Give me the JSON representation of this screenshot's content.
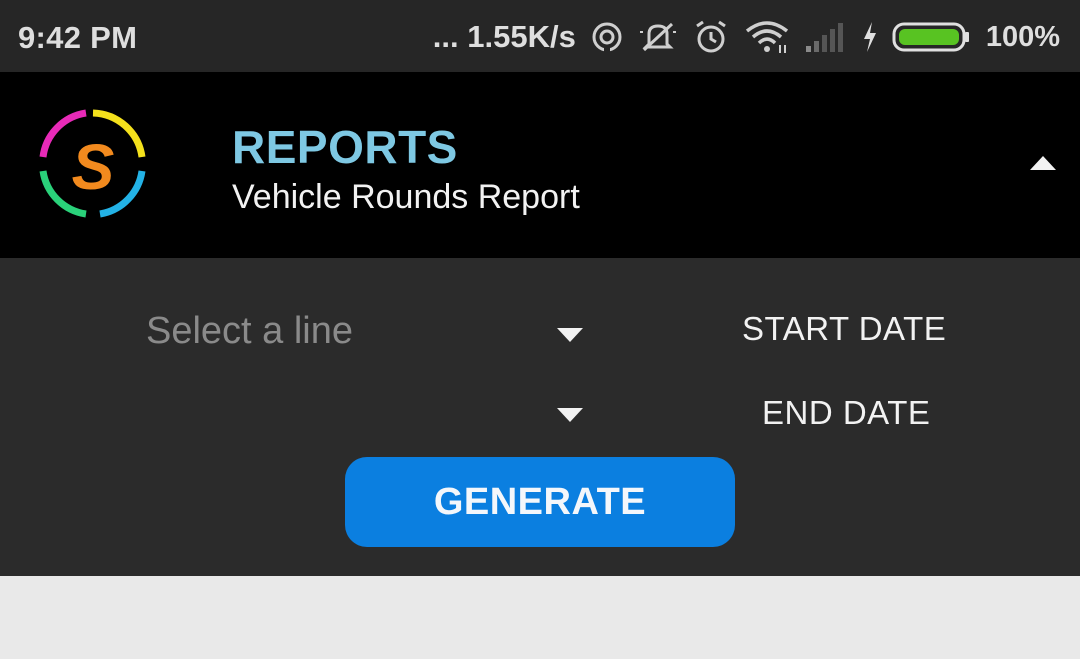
{
  "status_bar": {
    "time": "9:42 PM",
    "net_speed": "... 1.55K/s",
    "battery_percent": "100%",
    "icons": [
      "hotspot-icon",
      "mute-icon",
      "alarm-icon",
      "wifi-icon",
      "signal-icon",
      "charging-icon",
      "battery-icon"
    ],
    "battery_color": "#58c322"
  },
  "header": {
    "title": "REPORTS",
    "subtitle": "Vehicle Rounds Report",
    "title_color": "#7ec8e3",
    "logo_letter": "S",
    "logo_color": "#f28a1e"
  },
  "form": {
    "line_select_placeholder": "Select a line",
    "start_date_label": "START DATE",
    "end_date_label": "END DATE",
    "generate_label": "GENERATE",
    "button_color": "#0b7fe0"
  }
}
